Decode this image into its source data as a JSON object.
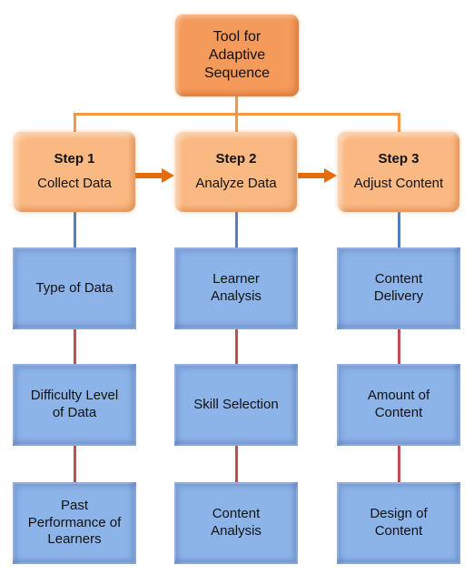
{
  "diagram": {
    "root": {
      "label": "Tool for Adaptive Sequence",
      "lines": [
        "Tool for",
        "Adaptive",
        "Sequence"
      ]
    },
    "steps": [
      {
        "step": "Step 1",
        "title": "Collect Data",
        "children": [
          {
            "lines": [
              "Type of Data"
            ]
          },
          {
            "lines": [
              "Difficulty Level",
              "of Data"
            ]
          },
          {
            "lines": [
              "Past",
              "Performance of",
              "Learners"
            ]
          }
        ]
      },
      {
        "step": "Step 2",
        "title": "Analyze Data",
        "children": [
          {
            "lines": [
              "Learner",
              "Analysis"
            ]
          },
          {
            "lines": [
              "Skill Selection"
            ]
          },
          {
            "lines": [
              "Content",
              "Analysis"
            ]
          }
        ]
      },
      {
        "step": "Step 3",
        "title": "Adjust Content",
        "children": [
          {
            "lines": [
              "Content",
              "Delivery"
            ]
          },
          {
            "lines": [
              "Amount of",
              "Content"
            ]
          },
          {
            "lines": [
              "Design of",
              "Content"
            ]
          }
        ]
      }
    ],
    "colors": {
      "root_fill": "#f49a5a",
      "step_fill": "#fab982",
      "leaf_fill": "#8db4e9",
      "tree_connector": "#f79646",
      "step_arrow": "#e46c0a",
      "step_to_leaf_connector": "#4f81bd",
      "leaf_to_leaf_connector": "#c0504d"
    }
  }
}
